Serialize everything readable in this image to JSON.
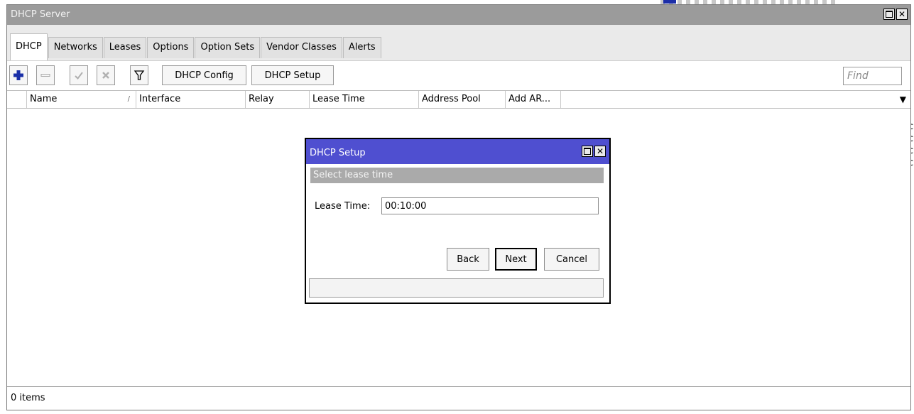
{
  "window": {
    "title": "DHCP Server"
  },
  "tabs": [
    {
      "label": "DHCP",
      "active": true
    },
    {
      "label": "Networks",
      "active": false
    },
    {
      "label": "Leases",
      "active": false
    },
    {
      "label": "Options",
      "active": false
    },
    {
      "label": "Option Sets",
      "active": false
    },
    {
      "label": "Vendor Classes",
      "active": false
    },
    {
      "label": "Alerts",
      "active": false
    }
  ],
  "toolbar": {
    "add_icon": "plus-icon",
    "remove_icon": "minus-icon",
    "enable_icon": "check-icon",
    "disable_icon": "cross-icon",
    "filter_icon": "filter-icon",
    "dhcp_config_label": "DHCP Config",
    "dhcp_setup_label": "DHCP Setup",
    "find_placeholder": "Find"
  },
  "table": {
    "columns": [
      "Name",
      "Interface",
      "Relay",
      "Lease Time",
      "Address Pool",
      "Add AR..."
    ],
    "sort_indicator": "/",
    "menu_glyph": "▼"
  },
  "status": {
    "items_text": "0 items"
  },
  "dialog": {
    "title": "DHCP Setup",
    "subtitle": "Select lease time",
    "field_label": "Lease Time:",
    "field_value": "00:10:00",
    "back_label": "Back",
    "next_label": "Next",
    "cancel_label": "Cancel"
  },
  "window_controls": {
    "close_glyph": "✕"
  },
  "background": {
    "edge_glyphs": [
      "c",
      "c",
      "c",
      "c"
    ]
  },
  "colors": {
    "dialog_titlebar": "#4f4fd0",
    "window_titlebar": "#9b9b9b",
    "subtitle_bar": "#aaaaaa",
    "add_icon": "#1a2fa8"
  }
}
